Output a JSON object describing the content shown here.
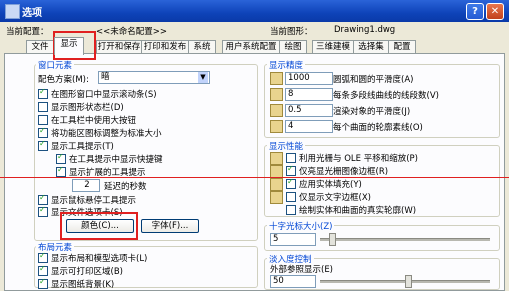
{
  "window": {
    "title": "选项",
    "help": "?",
    "close": "✕"
  },
  "header": {
    "profile_label": "当前配置：",
    "profile_value": "<<未命名配置>>",
    "drawing_label": "当前图形：",
    "drawing_value": "Drawing1.dwg"
  },
  "tabs": [
    "文件",
    "显示",
    "打开和保存",
    "打印和发布",
    "系统",
    "用户系统配置",
    "绘图",
    "三维建模",
    "选择集",
    "配置"
  ],
  "active_tab": "显示",
  "window_elements": {
    "title": "窗口元素",
    "color_scheme_label": "配色方案(M):",
    "color_scheme_value": "暗",
    "checkboxes": [
      "在图形窗口中显示滚动条(S)",
      "显示图形状态栏(D)",
      "在工具栏中使用大按钮",
      "将功能区图标调整为标准大小",
      "显示工具提示(T)",
      "在工具提示中显示快捷键",
      "显示扩展的工具提示",
      "显示鼠标悬停工具提示",
      "显示文件选项卡(S)"
    ],
    "delay_value": "2",
    "delay_label": "延迟的秒数",
    "color_button": "颜色(C)...",
    "font_button": "字体(F)..."
  },
  "layout_elements": {
    "title": "布局元素",
    "checkboxes": [
      "显示布局和模型选项卡(L)",
      "显示可打印区域(B)",
      "显示图纸背景(K)"
    ]
  },
  "display_precision": {
    "title": "显示精度",
    "rows": [
      {
        "value": "1000",
        "label": "圆弧和圆的平滑度(A)"
      },
      {
        "value": "8",
        "label": "每条多段线曲线的线段数(V)"
      },
      {
        "value": "0.5",
        "label": "渲染对象的平滑度(J)"
      },
      {
        "value": "4",
        "label": "每个曲面的轮廓素线(O)"
      }
    ]
  },
  "display_performance": {
    "title": "显示性能",
    "checkboxes": [
      "利用光栅与 OLE 平移和缩放(P)",
      "仅亮显光栅图像边框(R)",
      "应用实体填充(Y)",
      "仅显示文字边框(X)",
      "绘制实体和曲面的真实轮廓(W)"
    ]
  },
  "crosshair": {
    "title": "十字光标大小(Z)",
    "value": "5",
    "level": 0.05
  },
  "fade_control": {
    "title": "淡入度控制",
    "xref_label": "外部参照显示(E)",
    "xref_value": "50",
    "level": 0.5
  }
}
